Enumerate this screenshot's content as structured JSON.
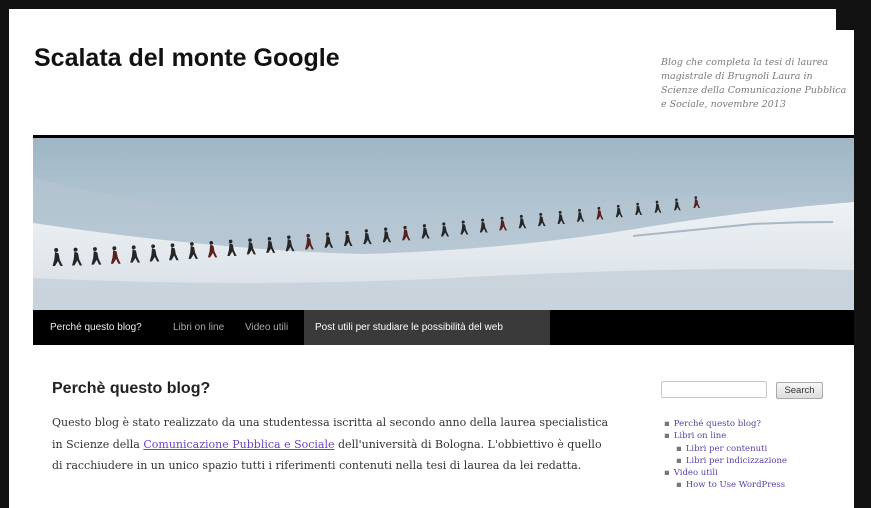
{
  "site": {
    "title": "Scalata del monte Google",
    "description": "Blog che completa la tesi di laurea magistrale di Brugnoli Laura in Scienze della Comunicazione Pubblica e Sociale, novembre 2013"
  },
  "nav": {
    "items": [
      "Perché questo blog?",
      "Libri on line",
      "Video utili",
      "Post utili per studiare le possibilità del web"
    ],
    "active_index": 3
  },
  "post": {
    "title": "Perchè questo blog?",
    "text_before_link": "Questo blog è stato realizzato da una studentessa iscritta al secondo anno della laurea specialistica in Scienze della ",
    "link_text": "Comunicazione Pubblica e Sociale",
    "text_after_link": " dell'università di Bologna. L'obbiettivo è quello di racchiudere in un unico spazio tutti i riferimenti contenuti nella tesi di laurea da lei redatta."
  },
  "search": {
    "value": "",
    "button_label": "Search"
  },
  "sidebar": {
    "pages": [
      "Perché questo blog?",
      "Libri on line",
      "Libri per contenuti",
      "Libri per indicizzazione",
      "Video utili",
      "How to Use WordPress"
    ]
  },
  "colors": {
    "nav_background": "#000000",
    "nav_active_background": "#3a3a3a",
    "link": "#6f42c1"
  }
}
